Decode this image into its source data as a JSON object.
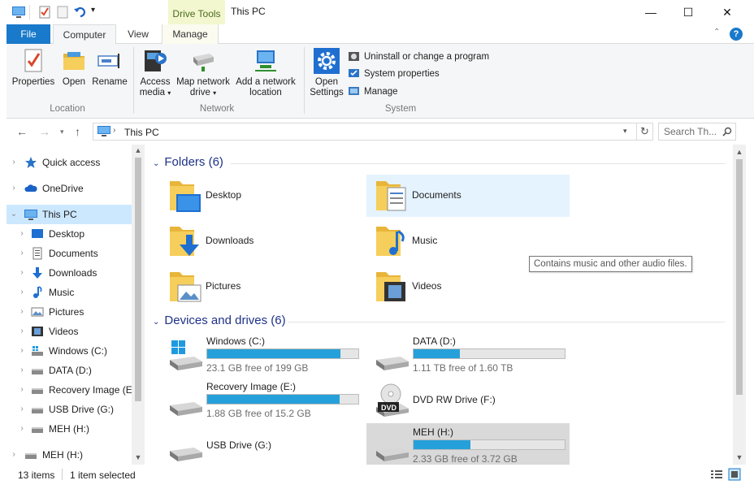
{
  "window": {
    "title": "This PC",
    "context_tab": "Drive Tools"
  },
  "tabs": [
    "File",
    "Computer",
    "View",
    "Manage"
  ],
  "ribbon": {
    "location": {
      "label": "Location",
      "properties": "Properties",
      "open": "Open",
      "rename": "Rename"
    },
    "network": {
      "label": "Network",
      "access_media": "Access media",
      "map_drive": "Map network drive",
      "add_location": "Add a network location"
    },
    "system": {
      "label": "System",
      "open_settings": "Open Settings",
      "uninstall": "Uninstall or change a program",
      "system_properties": "System properties",
      "manage": "Manage"
    }
  },
  "address": {
    "path": "This PC",
    "search_placeholder": "Search Th..."
  },
  "nav_pane": {
    "items": [
      {
        "label": "Quick access",
        "icon": "star-icon"
      },
      {
        "label": "OneDrive",
        "icon": "cloud-icon"
      },
      {
        "label": "This PC",
        "icon": "computer-icon"
      },
      {
        "label": "Desktop",
        "icon": "desktop-icon"
      },
      {
        "label": "Documents",
        "icon": "documents-icon"
      },
      {
        "label": "Downloads",
        "icon": "download-icon"
      },
      {
        "label": "Music",
        "icon": "music-icon"
      },
      {
        "label": "Pictures",
        "icon": "pictures-icon"
      },
      {
        "label": "Videos",
        "icon": "videos-icon"
      },
      {
        "label": "Windows (C:)",
        "icon": "windows-drive-icon"
      },
      {
        "label": "DATA (D:)",
        "icon": "drive-icon"
      },
      {
        "label": "Recovery Image (E:)",
        "icon": "drive-icon"
      },
      {
        "label": "USB Drive (G:)",
        "icon": "drive-icon"
      },
      {
        "label": "MEH (H:)",
        "icon": "drive-icon"
      },
      {
        "label": "MEH (H:)",
        "icon": "drive-icon"
      }
    ]
  },
  "folders": {
    "header": "Folders (6)",
    "items": [
      "Desktop",
      "Documents",
      "Downloads",
      "Music",
      "Pictures",
      "Videos"
    ]
  },
  "drives": {
    "header": "Devices and drives (6)",
    "items": [
      {
        "name": "Windows (C:)",
        "free": "23.1 GB free of 199 GB",
        "used_fraction": 0.884
      },
      {
        "name": "DATA (D:)",
        "free": "1.11 TB free of 1.60 TB",
        "used_fraction": 0.306
      },
      {
        "name": "Recovery Image (E:)",
        "free": "1.88 GB free of 15.2 GB",
        "used_fraction": 0.876
      },
      {
        "name": "DVD RW Drive (F:)",
        "badge": "DVD"
      },
      {
        "name": "USB Drive (G:)"
      },
      {
        "name": "MEH (H:)",
        "free": "2.33 GB free of 3.72 GB",
        "used_fraction": 0.374
      }
    ]
  },
  "tooltip": "Contains music and other audio files.",
  "status": {
    "items": "13 items",
    "selected": "1 item selected"
  },
  "colors": {
    "file_tab": "#1979ca",
    "selection": "#cce8ff",
    "header_blue": "#1e3287",
    "drive_bar": "#26a0da"
  }
}
